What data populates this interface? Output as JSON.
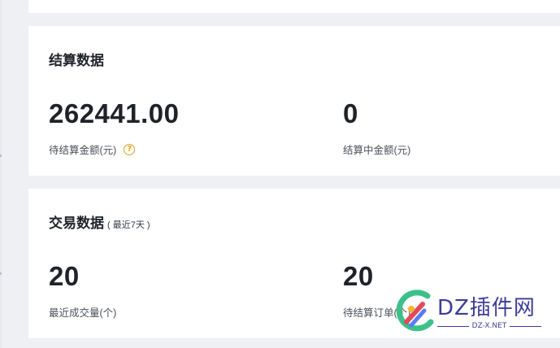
{
  "settlement": {
    "title": "结算数据",
    "pending_amount": {
      "value": "262441.00",
      "label": "待结算金额(元)"
    },
    "in_progress_amount": {
      "value": "0",
      "label": "结算中金额(元)"
    }
  },
  "trade": {
    "title": "交易数据",
    "subtitle": "( 最近7天 )",
    "recent_volume": {
      "value": "20",
      "label": "最近成交量(个)"
    },
    "pending_orders": {
      "value": "20",
      "label": "待结算订单(个)"
    }
  },
  "watermark": {
    "brand": "DZ插件网",
    "domain": "DZ-X.NET"
  },
  "colors": {
    "accent_help": "#e0a020",
    "watermark": "#3b3d99"
  },
  "icons": {
    "help": "question-circle-icon"
  }
}
